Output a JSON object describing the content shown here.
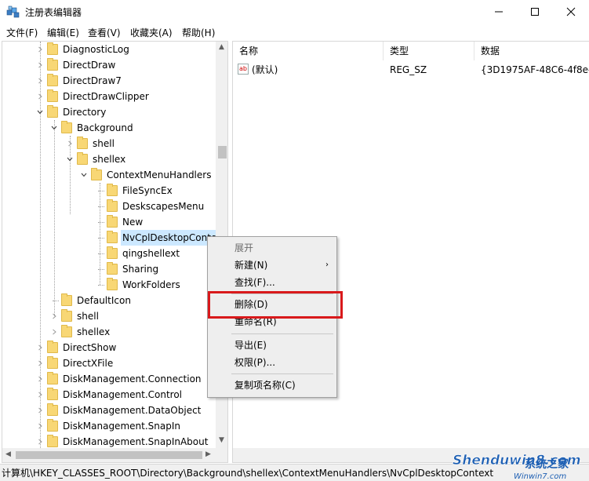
{
  "window": {
    "title": "注册表编辑器",
    "controls": [
      "minimize",
      "maximize",
      "close"
    ]
  },
  "menubar": {
    "items": [
      "文件(F)",
      "编辑(E)",
      "查看(V)",
      "收藏夹(A)",
      "帮助(H)"
    ]
  },
  "tree": {
    "items": [
      {
        "label": "DiagnosticLog",
        "level": 0,
        "expander": "closed"
      },
      {
        "label": "DirectDraw",
        "level": 0,
        "expander": "closed"
      },
      {
        "label": "DirectDraw7",
        "level": 0,
        "expander": "closed"
      },
      {
        "label": "DirectDrawClipper",
        "level": 0,
        "expander": "closed"
      },
      {
        "label": "Directory",
        "level": 0,
        "expander": "open"
      },
      {
        "label": "Background",
        "level": 1,
        "expander": "open"
      },
      {
        "label": "shell",
        "level": 2,
        "expander": "closed"
      },
      {
        "label": "shellex",
        "level": 2,
        "expander": "open"
      },
      {
        "label": "ContextMenuHandlers",
        "level": 3,
        "expander": "open"
      },
      {
        "label": "FileSyncEx",
        "level": 4,
        "expander": "none"
      },
      {
        "label": "DeskscapesMenu",
        "level": 4,
        "expander": "none"
      },
      {
        "label": "New",
        "level": 4,
        "expander": "none"
      },
      {
        "label": "NvCplDesktopContext",
        "level": 4,
        "expander": "none",
        "selected": true
      },
      {
        "label": "qingshellext",
        "level": 4,
        "expander": "none"
      },
      {
        "label": "Sharing",
        "level": 4,
        "expander": "none"
      },
      {
        "label": "WorkFolders",
        "level": 4,
        "expander": "none"
      },
      {
        "label": "DefaultIcon",
        "level": 1,
        "expander": "none"
      },
      {
        "label": "shell",
        "level": 1,
        "expander": "closed"
      },
      {
        "label": "shellex",
        "level": 1,
        "expander": "closed"
      },
      {
        "label": "DirectShow",
        "level": 0,
        "expander": "closed"
      },
      {
        "label": "DirectXFile",
        "level": 0,
        "expander": "closed"
      },
      {
        "label": "DiskManagement.Connection",
        "level": 0,
        "expander": "closed"
      },
      {
        "label": "DiskManagement.Control",
        "level": 0,
        "expander": "closed"
      },
      {
        "label": "DiskManagement.DataObject",
        "level": 0,
        "expander": "closed"
      },
      {
        "label": "DiskManagement.SnapIn",
        "level": 0,
        "expander": "closed"
      },
      {
        "label": "DiskManagement.SnapInAbout",
        "level": 0,
        "expander": "closed"
      }
    ]
  },
  "list": {
    "columns": [
      "名称",
      "类型",
      "数据"
    ],
    "rows": [
      {
        "name": "(默认)",
        "type": "REG_SZ",
        "data": "{3D1975AF-48C6-4f8e-"
      }
    ],
    "value_icon_text": "ab"
  },
  "context_menu": {
    "items": [
      {
        "label": "展开",
        "disabled": true
      },
      {
        "label": "新建(N)",
        "submenu": true
      },
      {
        "label": "查找(F)..."
      },
      {
        "separator": true
      },
      {
        "label": "删除(D)"
      },
      {
        "label": "重命名(R)"
      },
      {
        "separator": true
      },
      {
        "label": "导出(E)"
      },
      {
        "label": "权限(P)..."
      },
      {
        "separator": true
      },
      {
        "label": "复制项名称(C)"
      }
    ]
  },
  "statusbar": {
    "path": "计算机\\HKEY_CLASSES_ROOT\\Directory\\Background\\shellex\\ContextMenuHandlers\\NvCplDesktopContext"
  },
  "watermark": {
    "line1": "Shenduwin8.com",
    "line2": "系统之家",
    "line3": "Winwin7.com"
  },
  "colors": {
    "selection": "#cce8ff",
    "highlight_box": "#d9191b",
    "folder": "#f8d775"
  }
}
